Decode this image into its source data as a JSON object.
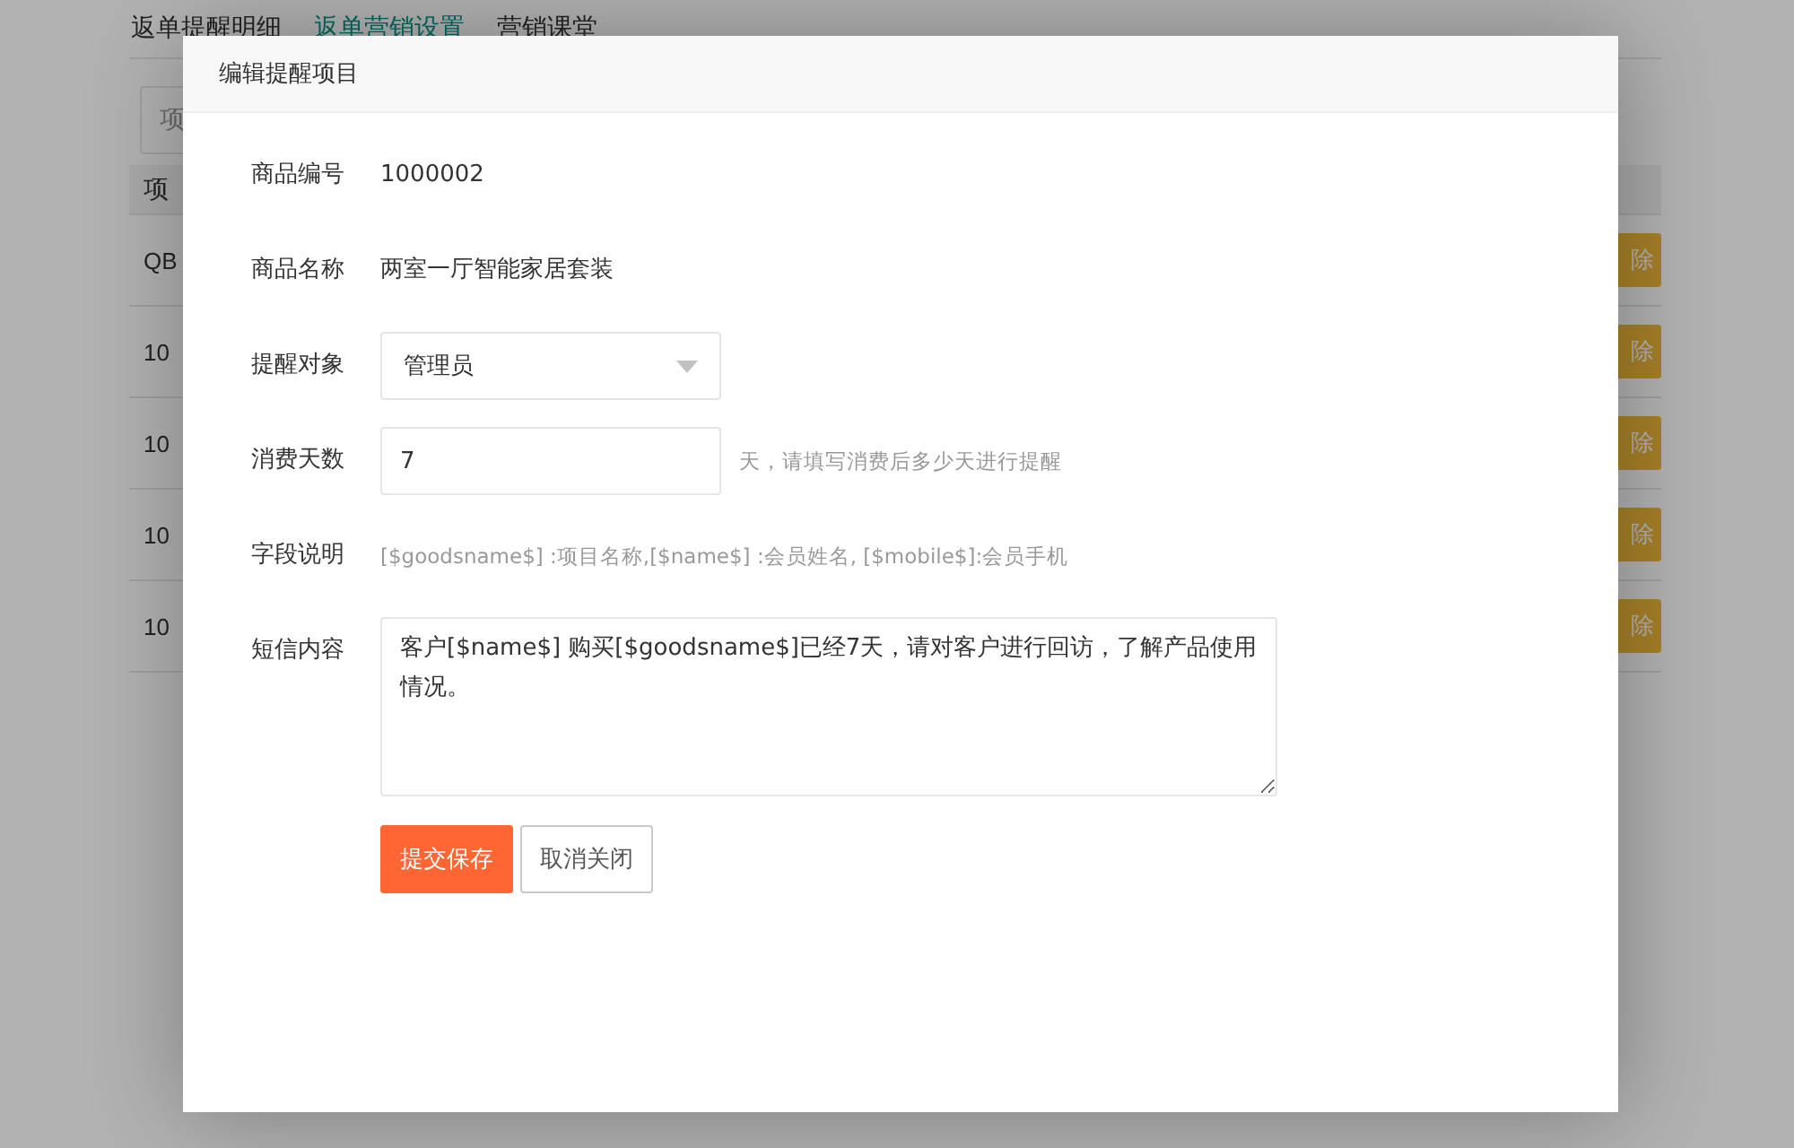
{
  "tabs": [
    {
      "label": "返单提醒明细",
      "selected": false
    },
    {
      "label": "返单营销设置",
      "selected": true
    },
    {
      "label": "营销课堂",
      "selected": false
    }
  ],
  "search": {
    "placeholder": "项"
  },
  "table": {
    "header": "项",
    "rows": [
      {
        "cell": "QB",
        "action": "除"
      },
      {
        "cell": "10",
        "action": "除"
      },
      {
        "cell": "10",
        "action": "除"
      },
      {
        "cell": "10",
        "action": "除"
      },
      {
        "cell": "10",
        "action": "除"
      }
    ]
  },
  "dialog": {
    "title": "编辑提醒项目",
    "fields": [
      {
        "kind": "text",
        "label": "商品编号",
        "value": "1000002"
      },
      {
        "kind": "text",
        "label": "商品名称",
        "value": "两室一厅智能家居套装"
      },
      {
        "kind": "select",
        "label": "提醒对象",
        "value": "管理员"
      },
      {
        "kind": "input",
        "label": "消费天数",
        "value": "7",
        "suffix": "天，请填写消费后多少天进行提醒"
      },
      {
        "kind": "note",
        "label": "字段说明",
        "value": "[$goodsname$] :项目名称,[$name$] :会员姓名, [$mobile$]:会员手机"
      },
      {
        "kind": "textarea",
        "label": "短信内容",
        "value": "客户[$name$] 购买[$goodsname$]已经7天，请对客户进行回访，了解产品使用情况。"
      }
    ],
    "buttons": [
      {
        "label": "提交保存",
        "kind": "primary"
      },
      {
        "label": "取消关闭",
        "kind": "default"
      }
    ]
  }
}
